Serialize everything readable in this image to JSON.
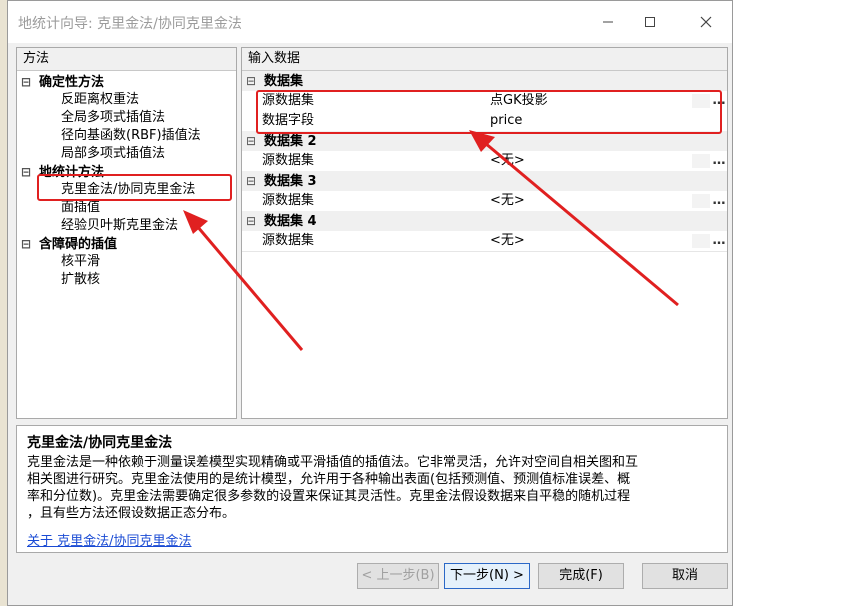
{
  "window": {
    "title": "地统计向导: 克里金法/协同克里金法"
  },
  "left_pane": {
    "header": "方法",
    "groups": [
      {
        "label": "确定性方法",
        "items": [
          "反距离权重法",
          "全局多项式插值法",
          "径向基函数(RBF)插值法",
          "局部多项式插值法"
        ]
      },
      {
        "label": "地统计方法",
        "items": [
          "克里金法/协同克里金法",
          "面插值",
          "经验贝叶斯克里金法"
        ]
      },
      {
        "label": "含障碍的插值",
        "items": [
          "核平滑",
          "扩散核"
        ]
      }
    ]
  },
  "right_pane": {
    "header": "输入数据",
    "datasets": [
      {
        "label": "数据集",
        "rows": [
          {
            "key": "源数据集",
            "value": "点GK投影"
          },
          {
            "key": "数据字段",
            "value": "price"
          }
        ]
      },
      {
        "label": "数据集 2",
        "rows": [
          {
            "key": "源数据集",
            "value": "<无>"
          }
        ]
      },
      {
        "label": "数据集 3",
        "rows": [
          {
            "key": "源数据集",
            "value": "<无>"
          }
        ]
      },
      {
        "label": "数据集 4",
        "rows": [
          {
            "key": "源数据集",
            "value": "<无>"
          }
        ]
      }
    ]
  },
  "description": {
    "title": "克里金法/协同克里金法",
    "lines": [
      "克里金法是一种依赖于测量误差模型实现精确或平滑插值的插值法。它非常灵活，允许对空间自相关图和互",
      "相关图进行研究。克里金法使用的是统计模型，允许用于各种输出表面(包括预测值、预测值标准误差、概",
      "率和分位数)。克里金法需要确定很多参数的设置来保证其灵活性。克里金法假设数据来自平稳的随机过程",
      "，且有些方法还假设数据正态分布。"
    ],
    "link": "关于 克里金法/协同克里金法"
  },
  "buttons": {
    "back": "< 上一步(B)",
    "next": "下一步(N) >",
    "finish": "完成(F)",
    "cancel": "取消"
  },
  "colors": {
    "annotation": "#e02020",
    "link": "#1a4bd4"
  }
}
